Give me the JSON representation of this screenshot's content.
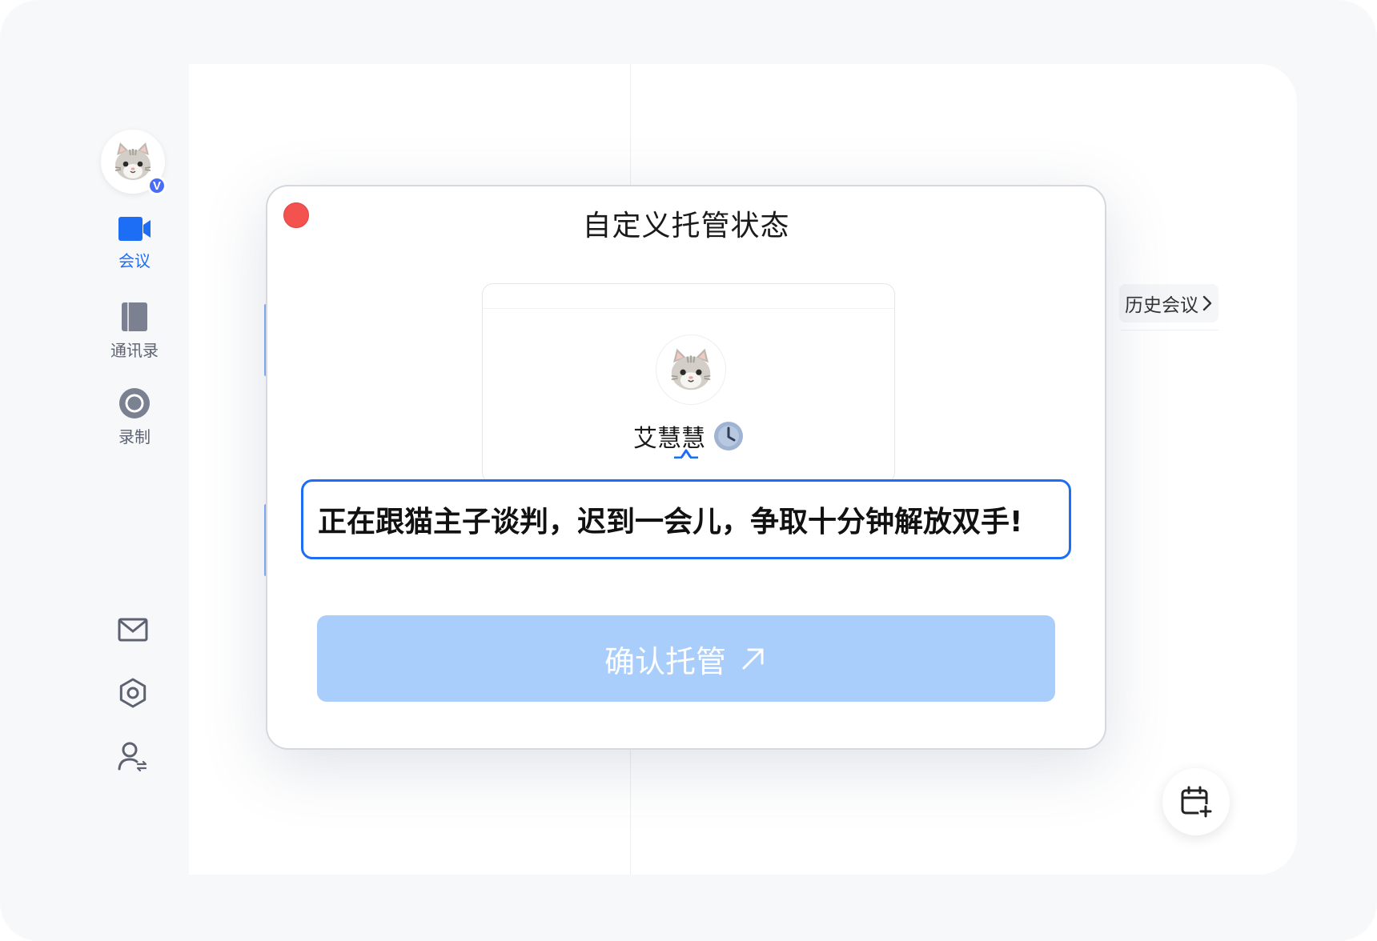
{
  "sidebar": {
    "avatar_badge": "V",
    "items": [
      {
        "label": "会议",
        "icon": "video-camera-icon",
        "active": true
      },
      {
        "label": "通讯录",
        "icon": "address-book-icon",
        "active": false
      },
      {
        "label": "录制",
        "icon": "record-icon",
        "active": false
      }
    ],
    "bottom_icons": [
      "mail-icon",
      "gear-icon",
      "switch-account-icon"
    ]
  },
  "main": {
    "history_label": "历史会议",
    "schedule_icon": "calendar-add-icon"
  },
  "dialog": {
    "title": "自定义托管状态",
    "user_name": "艾慧慧",
    "status_icon": "clock-icon",
    "status_text": "正在跟猫主子谈判，迟到一会儿，争取十分钟解放双手!",
    "confirm_label": "确认托管",
    "confirm_icon": "arrow-up-right-icon"
  },
  "colors": {
    "accent": "#1e6ef5",
    "confirm_disabled": "#a9cefb",
    "close": "#f4524f"
  }
}
